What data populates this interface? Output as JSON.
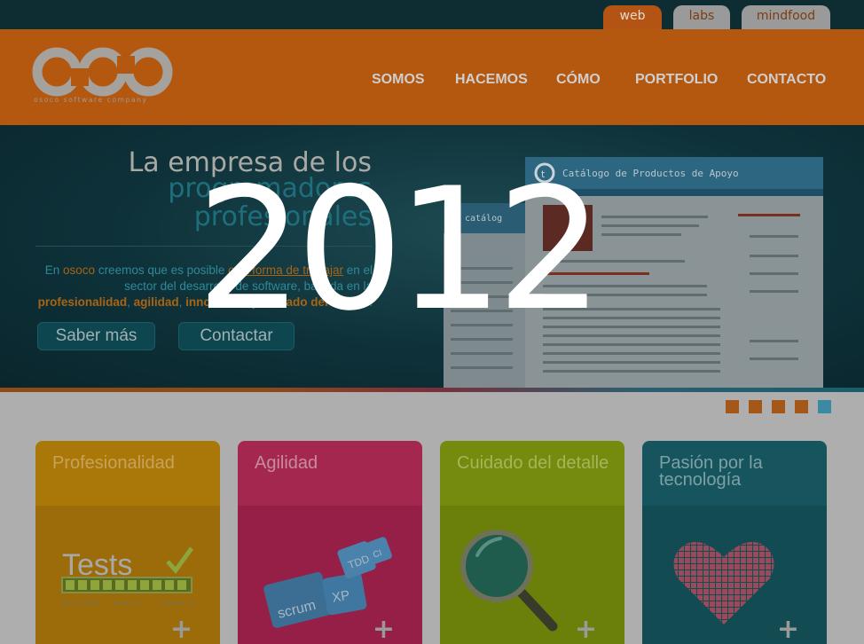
{
  "tabs": [
    {
      "label": "web",
      "active": true
    },
    {
      "label": "labs",
      "active": false
    },
    {
      "label": "mindfood",
      "active": false
    }
  ],
  "logo": {
    "text": "osco",
    "tagline": "osoco software company"
  },
  "nav": [
    "SOMOS",
    "HACEMOS",
    "CÓMO",
    "PORTFOLIO",
    "CONTACTO"
  ],
  "hero": {
    "title_line1": "La empresa de los",
    "title_line2": "programadores",
    "title_line3": "profesionales",
    "text": {
      "p1": "En ",
      "brand": "osoco",
      "p2": " creemos que es posible ",
      "link": "otra forma de trabajar",
      "p3": " en el sector del desarrollo de software, basada en la ",
      "v1": "profesionalidad",
      "sep1": ", ",
      "v2": "agilidad",
      "sep2": ", ",
      "v3": "innovación",
      "sep3": " y ",
      "v4": "cuidado del detalle",
      "end": "."
    },
    "buttons": {
      "more": "Saber más",
      "contact": "Contactar"
    },
    "screenshot": {
      "title": "Catálogo de Productos de Apoyo",
      "back_title": "catálog"
    }
  },
  "slider": {
    "count": 5,
    "active_index": 4
  },
  "cards": [
    {
      "title": "Profesionalidad",
      "art": "tests",
      "tests": {
        "word": "Tests",
        "runs": "Runs: 10/10",
        "errors": "Errors: 0",
        "failures": "Failures: 0"
      }
    },
    {
      "title": "Agilidad",
      "art": "agile",
      "tags": [
        "scrum",
        "XP",
        "TDD",
        "CI"
      ]
    },
    {
      "title": "Cuidado del detalle",
      "art": "magnifier"
    },
    {
      "title": "Pasión por la tecnología",
      "art": "pixel-heart"
    }
  ],
  "plus_symbol": "+",
  "overlay_year": "2012",
  "colors": {
    "header_orange": "#b4570f",
    "card_profesionalidad": "#a97808",
    "card_agilidad": "#a4274f",
    "card_cuidado": "#748b0d",
    "card_pasion": "#17555e",
    "slider_active": "#3b8aa3"
  }
}
